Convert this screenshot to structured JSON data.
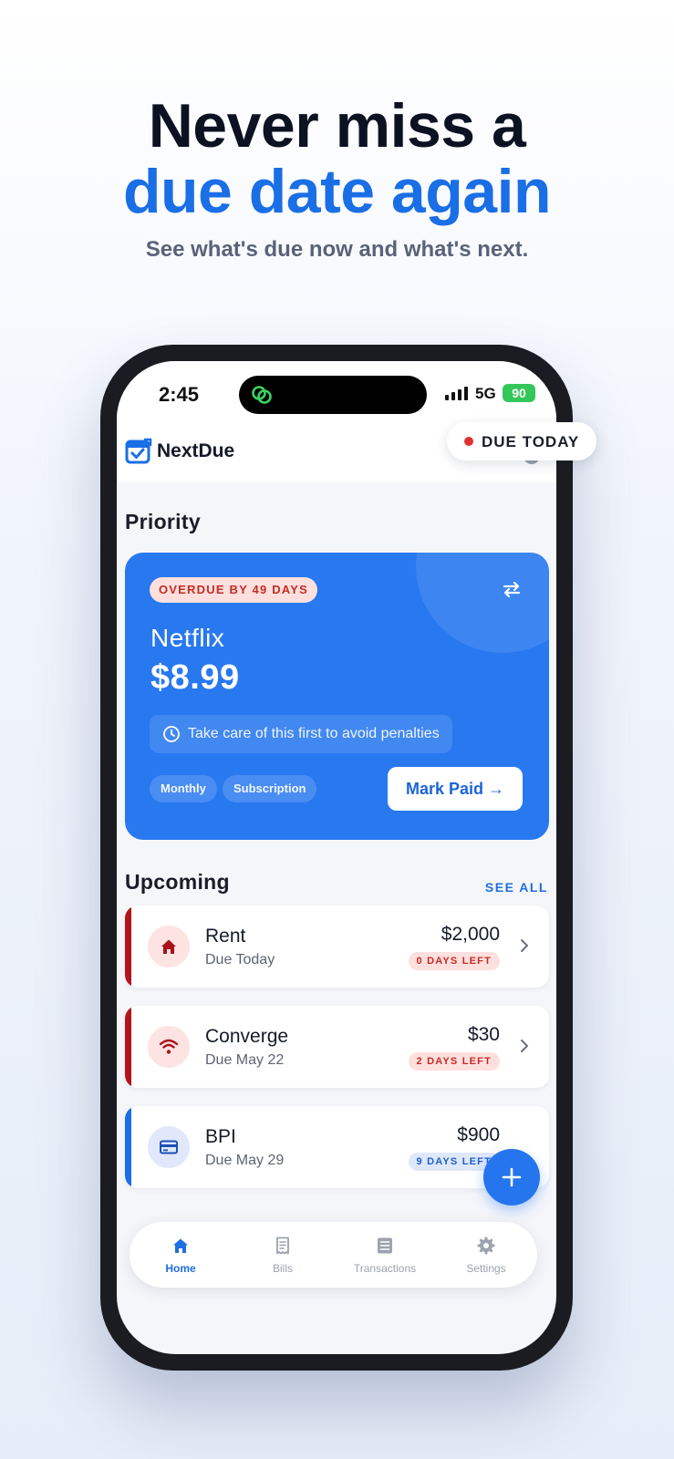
{
  "headline": {
    "line1": "Never miss a",
    "line2": "due date again",
    "subtitle": "See what's due now and what's next."
  },
  "status_bar": {
    "time": "2:45",
    "network": "5G",
    "battery": "90"
  },
  "app": {
    "name": "NextDue"
  },
  "due_today_pill": {
    "label": "DUE TODAY",
    "dot_color": "#e03131"
  },
  "priority": {
    "section_title": "Priority",
    "badge": "OVERDUE BY 49 DAYS",
    "name": "Netflix",
    "amount": "$8.99",
    "hint": "Take care of this first to avoid penalties",
    "tags": [
      "Monthly",
      "Subscription"
    ],
    "action_label": "Mark Paid →",
    "card_color": "#2878f0"
  },
  "upcoming": {
    "section_title": "Upcoming",
    "see_all_label": "SEE ALL",
    "bills": [
      {
        "name": "Rent",
        "due": "Due Today",
        "amount": "$2,000",
        "badge": "0 DAYS LEFT",
        "icon": "home-icon",
        "accent": "#b3151c"
      },
      {
        "name": "Converge",
        "due": "Due May 22",
        "amount": "$30",
        "badge": "2 DAYS LEFT",
        "icon": "wifi-icon",
        "accent": "#b3151c"
      },
      {
        "name": "BPI",
        "due": "Due May 29",
        "amount": "$900",
        "badge": "9 DAYS LEFT",
        "icon": "credit-card-icon",
        "accent": "#1a6ee6"
      }
    ]
  },
  "tab_bar": {
    "active": "Home",
    "tabs": [
      {
        "label": "Home",
        "icon": "home-icon"
      },
      {
        "label": "Bills",
        "icon": "receipt-icon"
      },
      {
        "label": "Transactions",
        "icon": "list-icon"
      },
      {
        "label": "Settings",
        "icon": "gear-icon"
      }
    ]
  }
}
